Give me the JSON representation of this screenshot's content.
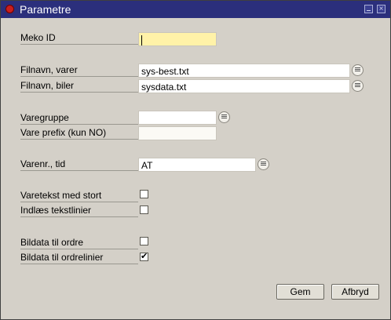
{
  "window": {
    "title": "Parametre"
  },
  "form": {
    "meko_id": {
      "label": "Meko ID",
      "value": ""
    },
    "filnavn_varer": {
      "label": "Filnavn, varer",
      "value": "sys-best.txt"
    },
    "filnavn_biler": {
      "label": "Filnavn, biler",
      "value": "sysdata.txt"
    },
    "varegruppe": {
      "label": "Varegruppe",
      "value": ""
    },
    "vare_prefix": {
      "label": "Vare prefix (kun NO)",
      "value": ""
    },
    "varenr_tid": {
      "label": "Varenr., tid",
      "value": "AT"
    },
    "varetekst_stort": {
      "label": "Varetekst med stort",
      "checked": false
    },
    "indlaes_tekstlinier": {
      "label": "Indlæs tekstlinier",
      "checked": false
    },
    "bildata_ordre": {
      "label": "Bildata til ordre",
      "checked": false
    },
    "bildata_ordrelinier": {
      "label": "Bildata til ordrelinier",
      "checked": true
    }
  },
  "buttons": {
    "save": "Gem",
    "cancel": "Afbryd"
  },
  "colors": {
    "titlebar": "#2b2f7c",
    "dialog_bg": "#d4d0c8",
    "focused_field": "#fff2a8"
  }
}
